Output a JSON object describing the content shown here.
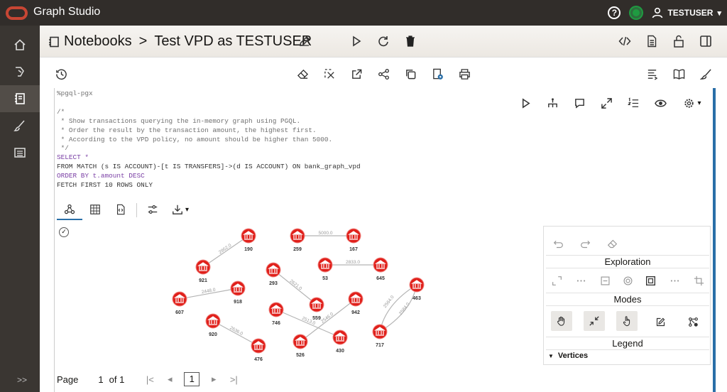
{
  "app": {
    "title": "Graph Studio",
    "user": "TESTUSER"
  },
  "header": {
    "breadcrumb_root": "Notebooks",
    "breadcrumb_sep": ">",
    "breadcrumb_current": "Test VPD as TESTUSER"
  },
  "code": {
    "lines": [
      "%pgql-pgx",
      "",
      "/*",
      " * Show transactions querying the in-memory graph using PGQL.",
      " * Order the result by the transaction amount, the highest first.",
      " * According to the VPD policy, no amount should be higher than 5000.",
      " */",
      "SELECT *",
      "FROM MATCH (s IS ACCOUNT)-[t IS TRANSFERS]->(d IS ACCOUNT) ON bank_graph_vpd",
      "ORDER BY t.amount DESC",
      "FETCH FIRST 10 ROWS ONLY"
    ]
  },
  "graph": {
    "nodes": [
      {
        "id": "190"
      },
      {
        "id": "921"
      },
      {
        "id": "259"
      },
      {
        "id": "167"
      },
      {
        "id": "293"
      },
      {
        "id": "53"
      },
      {
        "id": "645"
      },
      {
        "id": "463"
      },
      {
        "id": "607"
      },
      {
        "id": "918"
      },
      {
        "id": "559"
      },
      {
        "id": "942"
      },
      {
        "id": "746"
      },
      {
        "id": "920"
      },
      {
        "id": "717"
      },
      {
        "id": "430"
      },
      {
        "id": "526"
      },
      {
        "id": "476"
      }
    ],
    "edges": [
      {
        "from": "921",
        "to": "190",
        "label": "2962.0"
      },
      {
        "from": "259",
        "to": "167",
        "label": "5000.0"
      },
      {
        "from": "53",
        "to": "645",
        "label": "2833.0"
      },
      {
        "from": "607",
        "to": "918",
        "label": "2448.0"
      },
      {
        "from": "293",
        "to": "559",
        "label": "2621.0"
      },
      {
        "from": "526",
        "to": "942",
        "label": "2546.0"
      },
      {
        "from": "746",
        "to": "430",
        "label": "2513.0"
      },
      {
        "from": "920",
        "to": "476",
        "label": "2636.0"
      },
      {
        "from": "717",
        "to": "463",
        "label": "2564.0"
      },
      {
        "from": "463",
        "to": "717",
        "label": "2584.0"
      }
    ]
  },
  "pager": {
    "label": "Page",
    "current": "1",
    "of_label": "of 1",
    "box": "1"
  },
  "panel": {
    "exploration": "Exploration",
    "modes": "Modes",
    "legend": "Legend",
    "vertices": "Vertices"
  },
  "colors": {
    "node": "#e0201b",
    "accent": "#2a6fa8",
    "topbar": "#312d2a",
    "sidebar": "#3a3632"
  }
}
